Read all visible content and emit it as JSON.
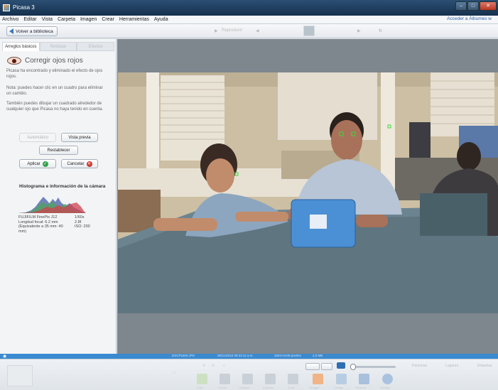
{
  "window": {
    "title": "Picasa 3"
  },
  "menu": {
    "items": [
      "Archivo",
      "Editar",
      "Vista",
      "Carpeta",
      "Imagen",
      "Crear",
      "Herramientas",
      "Ayuda"
    ],
    "right_link": "Acceder a Álbumes w"
  },
  "toolbar": {
    "back_label": "Volver a biblioteca",
    "play_label": "Reproducir"
  },
  "left_panel": {
    "tabs": [
      "Arreglos básicos",
      "Retoque",
      "Efectos"
    ],
    "tool_name": "Corregir ojos rojos",
    "para1": "Picasa ha encontrado y eliminado el efecto de ojos rojos.",
    "para2": "Nota: puedes hacer clic en un cuadro para eliminar un cambio.",
    "para3": "También puedes dibujar un cuadrado alrededor de cualquier ojo que Picasa no haya tenido en cuenta.",
    "btn_auto": "Automático",
    "btn_preview": "Vista previa",
    "btn_reset": "Restablecer",
    "btn_apply": "Aplicar",
    "btn_cancel": "Cancelar",
    "histogram_title": "Histograma e información de la cámara",
    "camera": {
      "row1_k": "FUJIFILM FinePix J12",
      "row1_v": "1/60s",
      "row2_k": "Longitud focal: 6.2 mm",
      "row2_v": "2.8f",
      "row3_k": "(Equivalente a 35 mm: 40",
      "row3_v": "ISO: 200",
      "row4_k": "mm)"
    }
  },
  "status": {
    "filename": "DSCF5494.JPG",
    "date": "06/11/2010 09:34:11 a.m.",
    "dims": "3264×2448 pixeles",
    "size": "2,3 MB"
  },
  "bottom": {
    "labels": [
      "Subir",
      "Correo",
      "Imprimir",
      "Exportar",
      "Crear",
      "Blogger",
      "Collage",
      "Película",
      "Geotag"
    ],
    "people": "Personas",
    "places": "Lugares",
    "tags": "Etiquetas"
  },
  "colors": {
    "accent": "#3a8ad0",
    "titlebar": "#1f3d5e"
  }
}
